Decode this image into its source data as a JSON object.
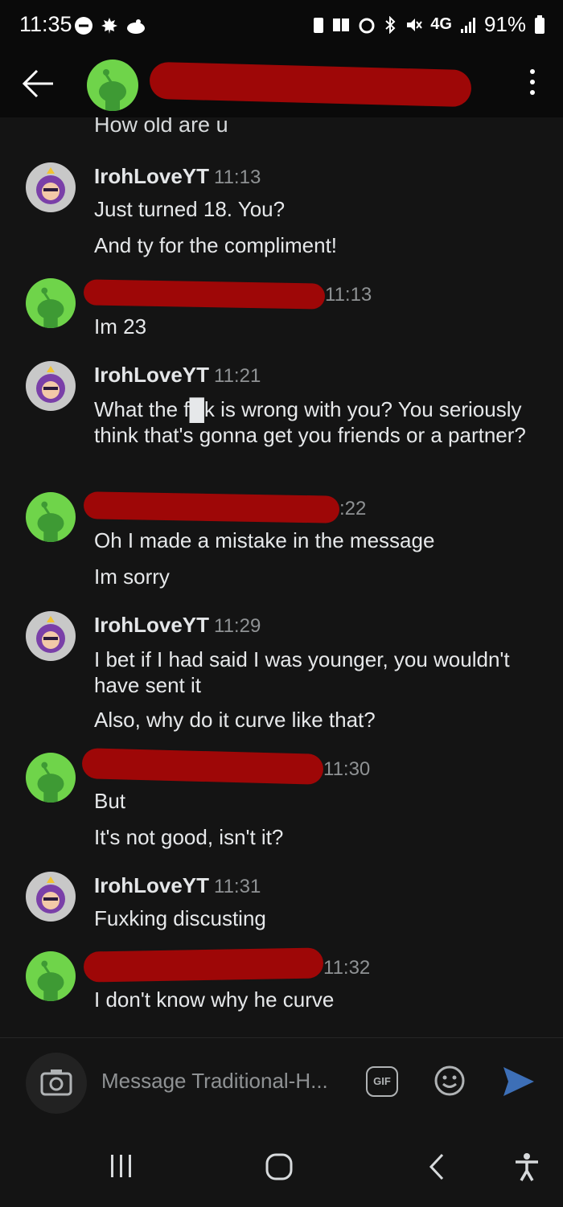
{
  "status_bar": {
    "time": "11:35",
    "network": "4G",
    "battery": "91%",
    "left_icons": [
      "minus-circle-icon",
      "maple-leaf-icon",
      "cloud-icon"
    ],
    "right_icons": [
      "battery-saver-icon",
      "book-icon",
      "alarm-icon",
      "bluetooth-icon",
      "mute-icon",
      "signal-icon",
      "battery-icon"
    ]
  },
  "header": {
    "back_icon": "arrow-left-icon",
    "avatar_icon": "reddit-snoo-icon",
    "username_redacted": true,
    "menu_icon": "kebab-menu-icon"
  },
  "chat": {
    "partial_previous": "How old are u",
    "messages": [
      {
        "author": "IrohLoveYT",
        "time": "11:13",
        "lines": [
          "Just turned 18. You?",
          "And ty for the compliment!"
        ]
      },
      {
        "author": "",
        "time": "11:13",
        "lines": [
          "Im 23"
        ]
      },
      {
        "author": "IrohLoveYT",
        "time": "11:21",
        "lines": [
          "What the f█k is wrong with you? You seriously think that's gonna get you friends or a partner?"
        ]
      },
      {
        "author": "",
        "time": ":22",
        "lines": [
          "Oh I made a mistake in the message",
          "Im sorry"
        ]
      },
      {
        "author": "IrohLoveYT",
        "time": "11:29",
        "lines": [
          "I bet if I had said I was younger, you wouldn't have sent it",
          "Also, why do it curve like that?"
        ]
      },
      {
        "author": "",
        "time": "11:30",
        "lines": [
          "But",
          "It's not good, isn't it?"
        ]
      },
      {
        "author": "IrohLoveYT",
        "time": "11:31",
        "lines": [
          "Fuxking discusting"
        ]
      },
      {
        "author": "",
        "time": "11:32",
        "lines": [
          "I don't know why he curve"
        ]
      }
    ]
  },
  "composer": {
    "placeholder": "Message Traditional-H...",
    "gif_label": "GIF",
    "camera_icon": "camera-icon",
    "emoji_icon": "emoji-icon",
    "send_icon": "send-icon"
  },
  "nav_bar": {
    "icons": [
      "recents-icon",
      "home-icon",
      "back-icon",
      "accessibility-icon"
    ]
  },
  "colors": {
    "background": "#141414",
    "redaction": "#9e0707",
    "snoo_green": "#6fd44a",
    "send_blue": "#3d6fb7"
  }
}
